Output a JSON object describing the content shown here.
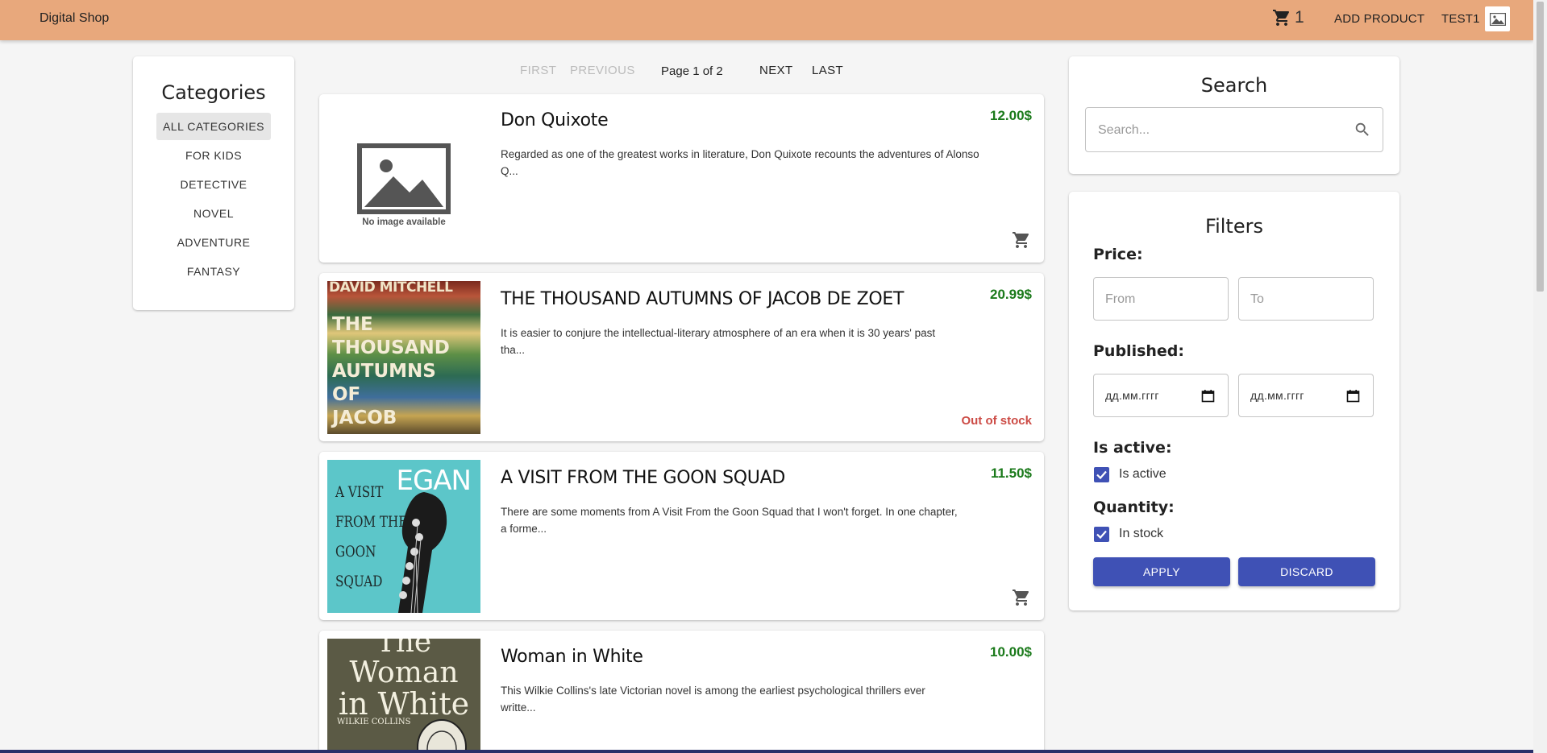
{
  "header": {
    "brand": "Digital Shop",
    "cart_count": "1",
    "add_product": "ADD PRODUCT",
    "user": "TEST1"
  },
  "categories": {
    "title": "Categories",
    "items": [
      "ALL CATEGORIES",
      "FOR KIDS",
      "DETECTIVE",
      "NOVEL",
      "ADVENTURE",
      "FANTASY"
    ],
    "active": "ALL CATEGORIES"
  },
  "pagination": {
    "first": "FIRST",
    "previous": "PREVIOUS",
    "page_info": "Page 1 of 2",
    "next": "NEXT",
    "last": "LAST"
  },
  "products": [
    {
      "title": "Don Quixote",
      "price": "12.00$",
      "description": "Regarded as one of the greatest works in literature, Don Quixote recounts the adventures of Alonso Q...",
      "image": "No image available",
      "status": "in-stock"
    },
    {
      "title": "THE THOUSAND AUTUMNS OF JACOB DE ZOET",
      "price": "20.99$",
      "description": "It is easier to conjure the intellectual-literary atmosphere of an era when it is 30 years' past tha...",
      "image_text": [
        "DAVID MITCHELL",
        "THE",
        "THOUSAND",
        "AUTUMNS",
        "OF",
        "JACOB"
      ],
      "status": "Out of stock"
    },
    {
      "title": "A VISIT FROM THE GOON SQUAD",
      "price": "11.50$",
      "description": "There are some moments from A Visit From the Goon Squad that I won't forget. In one chapter, a forme...",
      "image_text": [
        "EGAN",
        "A VISIT",
        "FROM THE",
        "GOON",
        "SQUAD"
      ],
      "status": "in-stock"
    },
    {
      "title": "Woman in White",
      "price": "10.00$",
      "description": "This Wilkie Collins's late Victorian novel is among the earliest psychological thrillers ever writte...",
      "image_text": [
        "The",
        "Woman",
        "in White",
        "WILKIE COLLINS"
      ],
      "status": "in-stock"
    }
  ],
  "search": {
    "title": "Search",
    "placeholder": "Search..."
  },
  "filters": {
    "title": "Filters",
    "price_label": "Price:",
    "price_from_placeholder": "From",
    "price_to_placeholder": "To",
    "published_label": "Published:",
    "date_placeholder": "дд.мм.гггг",
    "is_active_label": "Is active:",
    "is_active_checkbox": "Is active",
    "is_active_checked": true,
    "quantity_label": "Quantity:",
    "in_stock_checkbox": "In stock",
    "in_stock_checked": true,
    "apply": "APPLY",
    "discard": "DISCARD"
  },
  "colors": {
    "header_bg": "#e8a87c",
    "price_green": "#1b7a1b",
    "out_of_stock_red": "#cc4b45",
    "primary_button": "#3f51b5"
  }
}
